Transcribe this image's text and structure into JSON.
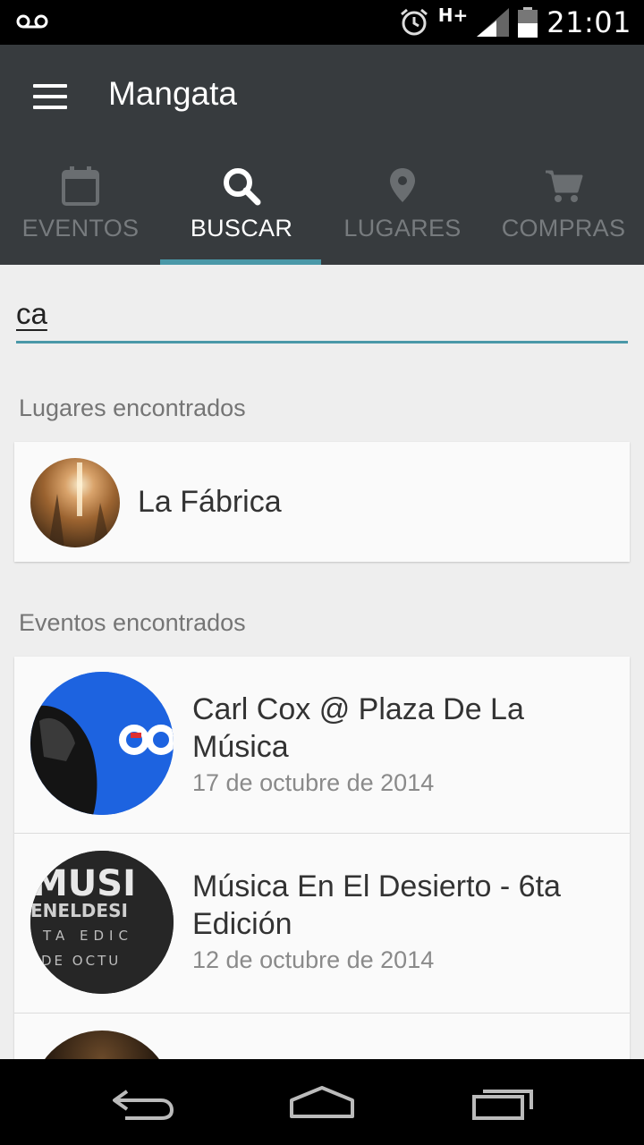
{
  "status_bar": {
    "network": "H+",
    "time": "21:01"
  },
  "toolbar": {
    "title": "Mangata"
  },
  "tabs": [
    {
      "label": "EVENTOS",
      "icon": "calendar-icon",
      "active": false
    },
    {
      "label": "BUSCAR",
      "icon": "search-icon",
      "active": true
    },
    {
      "label": "LUGARES",
      "icon": "location-pin-icon",
      "active": false
    },
    {
      "label": "COMPRAS",
      "icon": "cart-icon",
      "active": false
    }
  ],
  "search": {
    "value": "ca"
  },
  "places": {
    "header": "Lugares encontrados",
    "items": [
      {
        "name": "La Fábrica"
      }
    ]
  },
  "events": {
    "header": "Eventos encontrados",
    "items": [
      {
        "title_line1": "Carl Cox @ Plaza De La",
        "title_line2": "Música",
        "date": "17 de octubre de 2014"
      },
      {
        "title_line1": "Música En El Desierto - 6ta",
        "title_line2": "Edición",
        "date": "12 de octubre de 2014"
      }
    ]
  },
  "avatar_image_text": {
    "event2_top": "MUSI",
    "event2_mid": "ENELDESI",
    "event2_line3": "TA EDIC",
    "event2_line4": "DE OCTU"
  },
  "colors": {
    "toolbar": "#373b3e",
    "accent": "#4a98a8",
    "inactive_tab": "#777b7e"
  }
}
